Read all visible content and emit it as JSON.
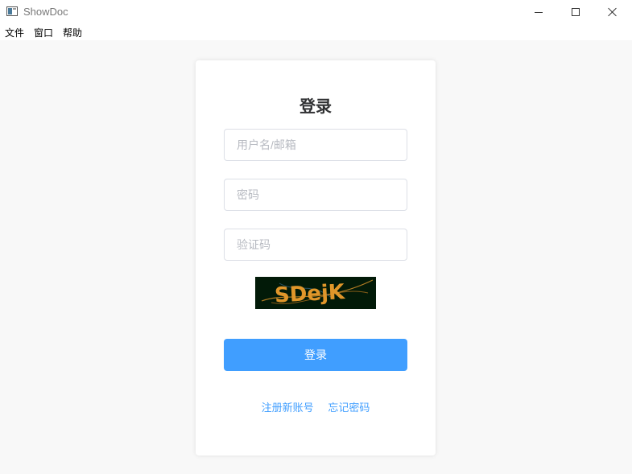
{
  "window": {
    "title": "ShowDoc",
    "icon": "app-window-icon"
  },
  "menu": [
    {
      "label": "文件"
    },
    {
      "label": "窗口"
    },
    {
      "label": "帮助"
    }
  ],
  "login": {
    "title": "登录",
    "username_placeholder": "用户名/邮箱",
    "password_placeholder": "密码",
    "captcha_placeholder": "验证码",
    "captcha_text": "SDejK",
    "submit_label": "登录",
    "register_link": "注册新账号",
    "forgot_link": "忘记密码"
  },
  "colors": {
    "accent": "#409eff",
    "background": "#f8f8f8",
    "card": "#ffffff",
    "captcha_bg": "#021a08",
    "captcha_text": "#e0962a"
  }
}
